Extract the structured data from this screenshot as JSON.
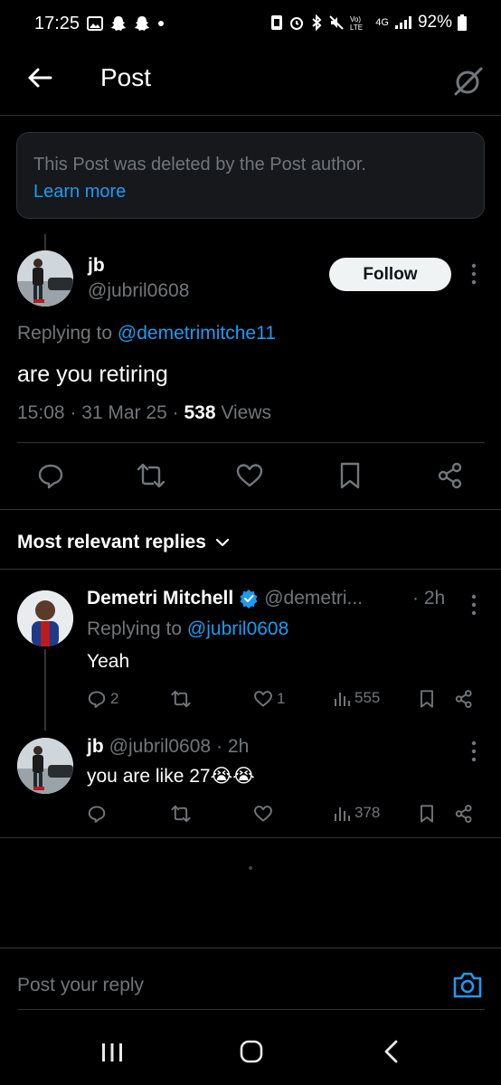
{
  "status_bar": {
    "time": "17:25",
    "battery": "92%",
    "network": "4G"
  },
  "header": {
    "title": "Post"
  },
  "deleted_notice": {
    "text": "This Post was deleted by the Post author.",
    "link": "Learn more"
  },
  "post": {
    "author_name": "jb",
    "author_handle": "@jubril0608",
    "follow_label": "Follow",
    "replying_prefix": "Replying to",
    "replying_to": "@demetrimitche11",
    "text": "are you retiring",
    "time": "15:08",
    "date": "31 Mar 25",
    "views_count": "538",
    "views_label": "Views"
  },
  "replies_section": {
    "title": "Most relevant replies"
  },
  "replies": [
    {
      "name": "Demetri Mitchell",
      "handle": "@demetri...",
      "time": "· 2h",
      "replying_prefix": "Replying to",
      "replying_to": "@jubril0608",
      "text": "Yeah",
      "reply_count": "2",
      "like_count": "1",
      "view_count": "555"
    },
    {
      "name": "jb",
      "handle": "@jubril0608",
      "time": "· 2h",
      "text": "you are like 27😭😭",
      "view_count": "378"
    }
  ],
  "composer": {
    "placeholder": "Post your reply"
  },
  "colors": {
    "background": "#000000",
    "accent": "#1d9bf0",
    "secondary_text": "#71767b",
    "divider": "#2f3336"
  },
  "icons": {
    "back": "arrow-left-icon",
    "grok": "grok-icon",
    "reply": "comment-icon",
    "repost": "repost-icon",
    "like": "heart-icon",
    "bookmark": "bookmark-icon",
    "share": "share-icon",
    "views": "bar-chart-icon",
    "camera": "camera-icon"
  }
}
